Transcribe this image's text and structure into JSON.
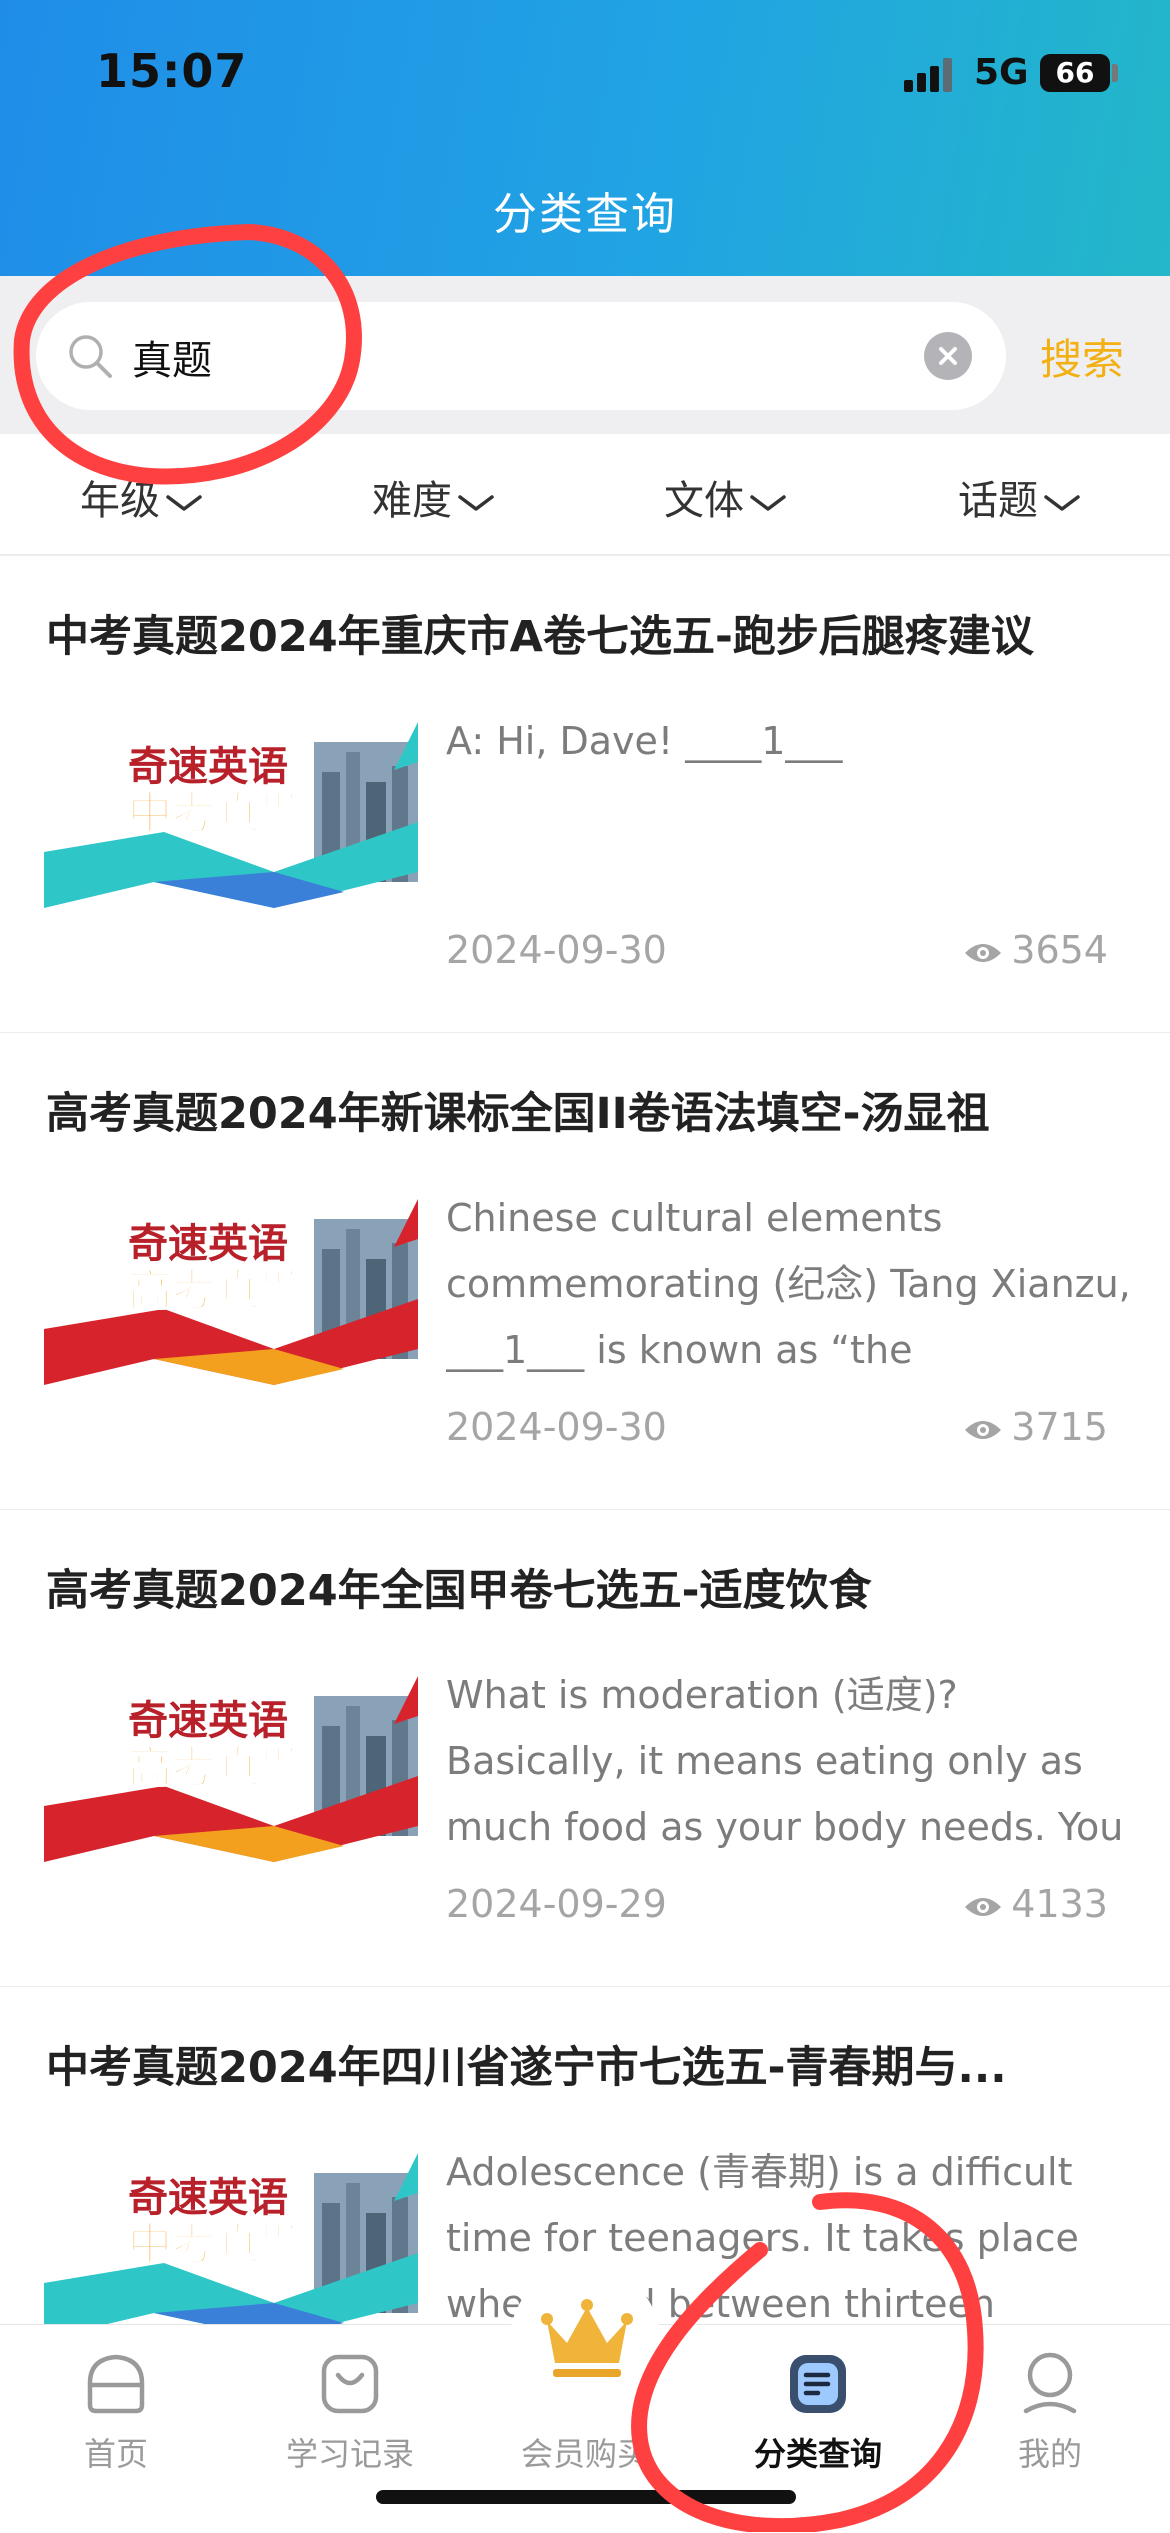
{
  "status_bar": {
    "time": "15:07",
    "network": "5G",
    "battery": "66"
  },
  "header": {
    "title": "分类查询"
  },
  "search": {
    "value": "真题",
    "button_label": "搜索"
  },
  "filters": [
    "年级",
    "难度",
    "文体",
    "话题"
  ],
  "articles": [
    {
      "title": "中考真题2024年重庆市A卷七选五-跑步后腿疼建议",
      "thumb_line1": "奇速英语",
      "thumb_line2": "中考真题",
      "thumb_variant": "teal",
      "excerpt": "A: Hi, Dave! ____1___",
      "date": "2024-09-30",
      "views": "3654"
    },
    {
      "title": "高考真题2024年新课标全国II卷语法填空-汤显祖",
      "thumb_line1": "奇速英语",
      "thumb_line2": "高考真题",
      "thumb_variant": "red",
      "excerpt": "Chinese cultural elements commemorating (纪念) Tang Xianzu, ___1___ is known as “the",
      "date": "2024-09-30",
      "views": "3715"
    },
    {
      "title": "高考真题2024年全国甲卷七选五-适度饮食",
      "thumb_line1": "奇速英语",
      "thumb_line2": "高考真题",
      "thumb_variant": "red",
      "excerpt": "What is moderation (适度)? Basically, it means eating only as much food as your body needs. You",
      "date": "2024-09-29",
      "views": "4133"
    },
    {
      "title": "中考真题2024年四川省遂宁市七选五-青春期与...",
      "thumb_line1": "奇速英语",
      "thumb_line2": "中考真题",
      "thumb_variant": "teal",
      "excerpt": "Adolescence (青春期) is a difficult time for teenagers. It takes place when aged between thirteen",
      "date": "",
      "views": ""
    }
  ],
  "tabbar": {
    "items": [
      {
        "label": "首页",
        "icon": "home-icon"
      },
      {
        "label": "学习记录",
        "icon": "bag-icon"
      },
      {
        "label": "会员购买",
        "icon": "crown-icon"
      },
      {
        "label": "分类查询",
        "icon": "list-icon",
        "active": true
      },
      {
        "label": "我的",
        "icon": "user-icon"
      }
    ]
  },
  "colors": {
    "header_start": "#1f8de8",
    "header_end": "#23b7c9",
    "accent": "#f2b014",
    "annotation": "#ff4040"
  }
}
